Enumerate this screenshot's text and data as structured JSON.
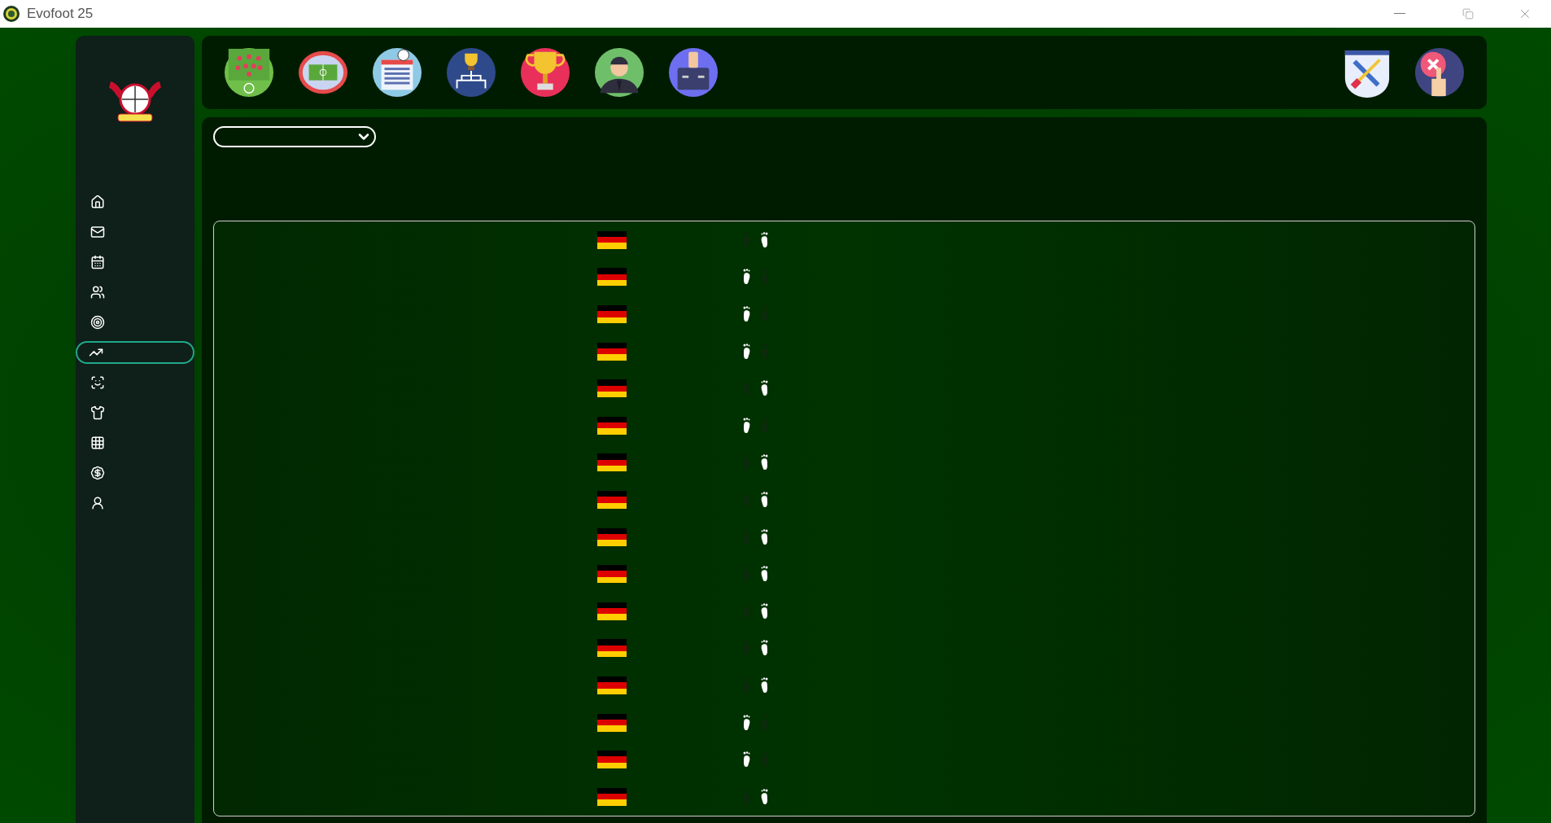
{
  "window": {
    "title": "Evofoot 25"
  },
  "sidebar": {
    "items": [
      {
        "kind": "home",
        "selected": false
      },
      {
        "kind": "mail",
        "selected": false
      },
      {
        "kind": "calendar",
        "selected": false
      },
      {
        "kind": "squad",
        "selected": false
      },
      {
        "kind": "training",
        "selected": false
      },
      {
        "kind": "progress",
        "selected": true
      },
      {
        "kind": "scouting",
        "selected": false
      },
      {
        "kind": "shirt",
        "selected": false
      },
      {
        "kind": "fixtures",
        "selected": false
      },
      {
        "kind": "finance",
        "selected": false
      },
      {
        "kind": "staff",
        "selected": false
      }
    ]
  },
  "toolbar": {
    "left": [
      {
        "kind": "tactics"
      },
      {
        "kind": "stadium"
      },
      {
        "kind": "table"
      },
      {
        "kind": "bracket"
      },
      {
        "kind": "trophy"
      },
      {
        "kind": "manager"
      },
      {
        "kind": "briefcase"
      }
    ],
    "right": [
      {
        "kind": "tools"
      },
      {
        "kind": "quit"
      }
    ]
  },
  "players": [
    {
      "left_foot": false,
      "right_foot": true
    },
    {
      "left_foot": true,
      "right_foot": false
    },
    {
      "left_foot": true,
      "right_foot": false
    },
    {
      "left_foot": true,
      "right_foot": false
    },
    {
      "left_foot": false,
      "right_foot": true
    },
    {
      "left_foot": true,
      "right_foot": false
    },
    {
      "left_foot": false,
      "right_foot": true
    },
    {
      "left_foot": false,
      "right_foot": true
    },
    {
      "left_foot": false,
      "right_foot": true
    },
    {
      "left_foot": false,
      "right_foot": true
    },
    {
      "left_foot": false,
      "right_foot": true
    },
    {
      "left_foot": false,
      "right_foot": true
    },
    {
      "left_foot": false,
      "right_foot": true
    },
    {
      "left_foot": true,
      "right_foot": false
    },
    {
      "left_foot": true,
      "right_foot": false
    },
    {
      "left_foot": false,
      "right_foot": true
    }
  ]
}
